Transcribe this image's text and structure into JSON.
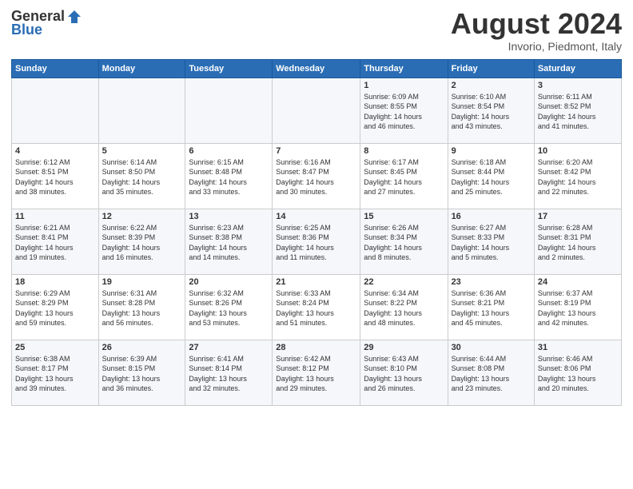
{
  "header": {
    "logo": {
      "general": "General",
      "blue": "Blue"
    },
    "title": "August 2024",
    "location": "Invorio, Piedmont, Italy"
  },
  "days_of_week": [
    "Sunday",
    "Monday",
    "Tuesday",
    "Wednesday",
    "Thursday",
    "Friday",
    "Saturday"
  ],
  "weeks": [
    [
      {
        "day": "",
        "info": ""
      },
      {
        "day": "",
        "info": ""
      },
      {
        "day": "",
        "info": ""
      },
      {
        "day": "",
        "info": ""
      },
      {
        "day": "1",
        "info": "Sunrise: 6:09 AM\nSunset: 8:55 PM\nDaylight: 14 hours\nand 46 minutes."
      },
      {
        "day": "2",
        "info": "Sunrise: 6:10 AM\nSunset: 8:54 PM\nDaylight: 14 hours\nand 43 minutes."
      },
      {
        "day": "3",
        "info": "Sunrise: 6:11 AM\nSunset: 8:52 PM\nDaylight: 14 hours\nand 41 minutes."
      }
    ],
    [
      {
        "day": "4",
        "info": "Sunrise: 6:12 AM\nSunset: 8:51 PM\nDaylight: 14 hours\nand 38 minutes."
      },
      {
        "day": "5",
        "info": "Sunrise: 6:14 AM\nSunset: 8:50 PM\nDaylight: 14 hours\nand 35 minutes."
      },
      {
        "day": "6",
        "info": "Sunrise: 6:15 AM\nSunset: 8:48 PM\nDaylight: 14 hours\nand 33 minutes."
      },
      {
        "day": "7",
        "info": "Sunrise: 6:16 AM\nSunset: 8:47 PM\nDaylight: 14 hours\nand 30 minutes."
      },
      {
        "day": "8",
        "info": "Sunrise: 6:17 AM\nSunset: 8:45 PM\nDaylight: 14 hours\nand 27 minutes."
      },
      {
        "day": "9",
        "info": "Sunrise: 6:18 AM\nSunset: 8:44 PM\nDaylight: 14 hours\nand 25 minutes."
      },
      {
        "day": "10",
        "info": "Sunrise: 6:20 AM\nSunset: 8:42 PM\nDaylight: 14 hours\nand 22 minutes."
      }
    ],
    [
      {
        "day": "11",
        "info": "Sunrise: 6:21 AM\nSunset: 8:41 PM\nDaylight: 14 hours\nand 19 minutes."
      },
      {
        "day": "12",
        "info": "Sunrise: 6:22 AM\nSunset: 8:39 PM\nDaylight: 14 hours\nand 16 minutes."
      },
      {
        "day": "13",
        "info": "Sunrise: 6:23 AM\nSunset: 8:38 PM\nDaylight: 14 hours\nand 14 minutes."
      },
      {
        "day": "14",
        "info": "Sunrise: 6:25 AM\nSunset: 8:36 PM\nDaylight: 14 hours\nand 11 minutes."
      },
      {
        "day": "15",
        "info": "Sunrise: 6:26 AM\nSunset: 8:34 PM\nDaylight: 14 hours\nand 8 minutes."
      },
      {
        "day": "16",
        "info": "Sunrise: 6:27 AM\nSunset: 8:33 PM\nDaylight: 14 hours\nand 5 minutes."
      },
      {
        "day": "17",
        "info": "Sunrise: 6:28 AM\nSunset: 8:31 PM\nDaylight: 14 hours\nand 2 minutes."
      }
    ],
    [
      {
        "day": "18",
        "info": "Sunrise: 6:29 AM\nSunset: 8:29 PM\nDaylight: 13 hours\nand 59 minutes."
      },
      {
        "day": "19",
        "info": "Sunrise: 6:31 AM\nSunset: 8:28 PM\nDaylight: 13 hours\nand 56 minutes."
      },
      {
        "day": "20",
        "info": "Sunrise: 6:32 AM\nSunset: 8:26 PM\nDaylight: 13 hours\nand 53 minutes."
      },
      {
        "day": "21",
        "info": "Sunrise: 6:33 AM\nSunset: 8:24 PM\nDaylight: 13 hours\nand 51 minutes."
      },
      {
        "day": "22",
        "info": "Sunrise: 6:34 AM\nSunset: 8:22 PM\nDaylight: 13 hours\nand 48 minutes."
      },
      {
        "day": "23",
        "info": "Sunrise: 6:36 AM\nSunset: 8:21 PM\nDaylight: 13 hours\nand 45 minutes."
      },
      {
        "day": "24",
        "info": "Sunrise: 6:37 AM\nSunset: 8:19 PM\nDaylight: 13 hours\nand 42 minutes."
      }
    ],
    [
      {
        "day": "25",
        "info": "Sunrise: 6:38 AM\nSunset: 8:17 PM\nDaylight: 13 hours\nand 39 minutes."
      },
      {
        "day": "26",
        "info": "Sunrise: 6:39 AM\nSunset: 8:15 PM\nDaylight: 13 hours\nand 36 minutes."
      },
      {
        "day": "27",
        "info": "Sunrise: 6:41 AM\nSunset: 8:14 PM\nDaylight: 13 hours\nand 32 minutes."
      },
      {
        "day": "28",
        "info": "Sunrise: 6:42 AM\nSunset: 8:12 PM\nDaylight: 13 hours\nand 29 minutes."
      },
      {
        "day": "29",
        "info": "Sunrise: 6:43 AM\nSunset: 8:10 PM\nDaylight: 13 hours\nand 26 minutes."
      },
      {
        "day": "30",
        "info": "Sunrise: 6:44 AM\nSunset: 8:08 PM\nDaylight: 13 hours\nand 23 minutes."
      },
      {
        "day": "31",
        "info": "Sunrise: 6:46 AM\nSunset: 8:06 PM\nDaylight: 13 hours\nand 20 minutes."
      }
    ]
  ]
}
